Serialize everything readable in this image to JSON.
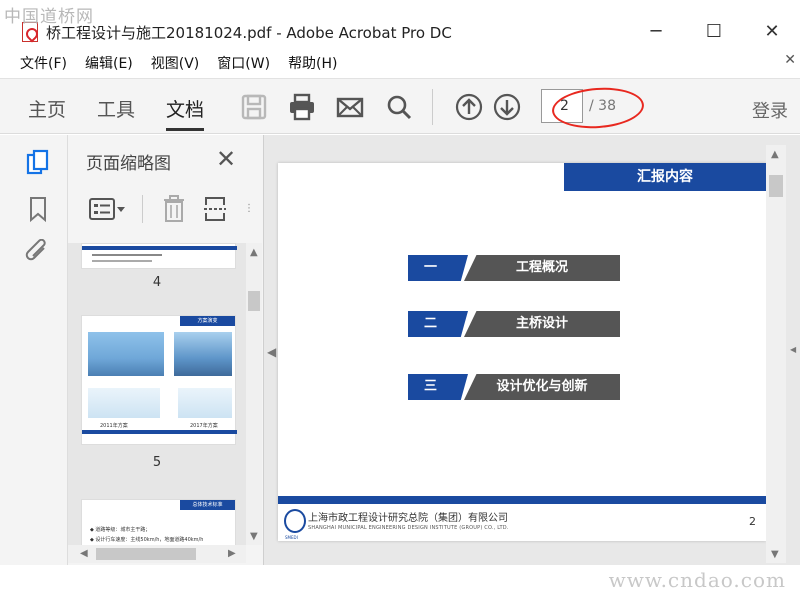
{
  "watermarks": {
    "top": "中国道桥网",
    "bottom": "www.cndao.com"
  },
  "window": {
    "title": "桥工程设计与施工20181024.pdf - Adobe Acrobat Pro DC",
    "minimize": "─",
    "maximize": "☐",
    "close": "✕"
  },
  "menu": {
    "items": [
      "文件(F)",
      "编辑(E)",
      "视图(V)",
      "窗口(W)",
      "帮助(H)"
    ],
    "close": "✕"
  },
  "toolbar": {
    "tabs": [
      "主页",
      "工具",
      "文档"
    ],
    "active_tab": "文档",
    "current_page": "2",
    "total_pages": "/ 38",
    "login": "登录"
  },
  "thumbnails": {
    "title": "页面缩略图",
    "close": "✕",
    "pages": [
      {
        "number": "4"
      },
      {
        "number": "5",
        "header": "方案演变",
        "captions": [
          "2011年方案",
          "2017年方案"
        ]
      },
      {
        "header": "总体技术标准",
        "lines": [
          "◆ 道路等级：城市主干路；",
          "◆ 设计行车速度：主线50km/h，地面道路40km/h"
        ]
      }
    ]
  },
  "document": {
    "header": "汇报内容",
    "agenda": [
      {
        "num": "一",
        "label": "工程概况"
      },
      {
        "num": "二",
        "label": "主桥设计"
      },
      {
        "num": "三",
        "label": "设计优化与创新"
      }
    ],
    "footer_cn": "上海市政工程设计研究总院（集团）有限公司",
    "footer_en": "SHANGHAI MUNICIPAL ENGINEERING DESIGN INSTITUTE (GROUP) CO., LTD.",
    "footer_logo_text": "SMEDI",
    "page_number": "2"
  },
  "colors": {
    "brand_blue": "#1a4aa0",
    "agenda_grey": "#555555",
    "annotation_red": "#e8281f"
  }
}
